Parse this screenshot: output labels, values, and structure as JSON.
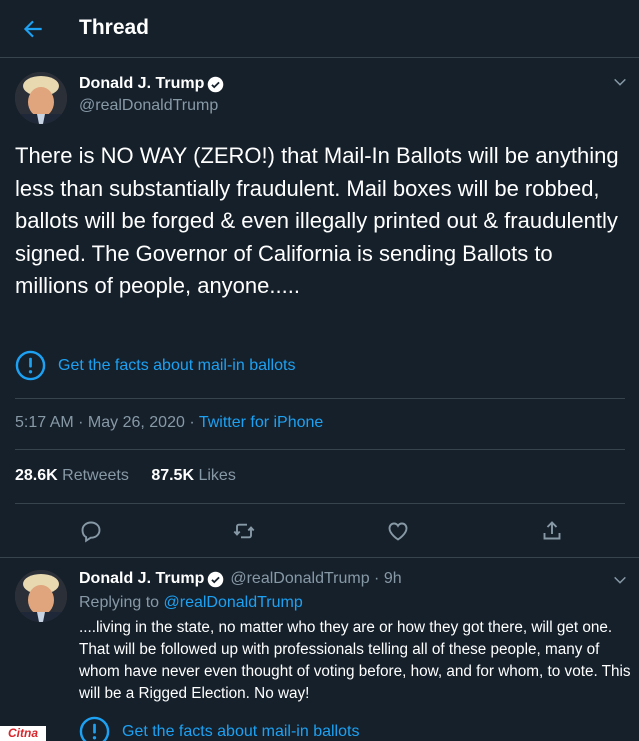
{
  "header": {
    "title": "Thread"
  },
  "tweet": {
    "author_name": "Donald J. Trump",
    "author_handle": "@realDonaldTrump",
    "text": "There is NO WAY (ZERO!) that Mail-In Ballots will be anything less than substantially fraudulent. Mail boxes will be robbed, ballots will be forged & even illegally printed out & fraudulently signed. The Governor of California is sending Ballots to millions of people, anyone.....",
    "facts_label": "Get the facts about mail-in ballots",
    "time": "5:17 AM · May 26, 2020 · ",
    "source": "Twitter for iPhone",
    "retweets_count": "28.6K",
    "retweets_label": "Retweets",
    "likes_count": "87.5K",
    "likes_label": "Likes"
  },
  "reply": {
    "author_name": "Donald J. Trump",
    "author_meta": "@realDonaldTrump · 9h",
    "replying_prefix": "Replying to ",
    "replying_handle": "@realDonaldTrump",
    "text": "....living in the state, no matter who they are or how they got there, will get one. That will be followed up with professionals telling all of these people, many of whom have never even thought of voting before, how, and for whom, to vote. This will be a Rigged Election. No way!",
    "facts_label": "Get the facts about mail-in ballots"
  },
  "watermark": {
    "text": "Citna"
  },
  "colors": {
    "background": "#15202b",
    "accent": "#1da1f2",
    "secondary_text": "#8899a6",
    "divider": "#38444d"
  },
  "icons": [
    "back-arrow-icon",
    "verified-badge-icon",
    "chevron-down-icon",
    "info-icon",
    "reply-icon",
    "retweet-icon",
    "like-icon",
    "share-icon"
  ]
}
